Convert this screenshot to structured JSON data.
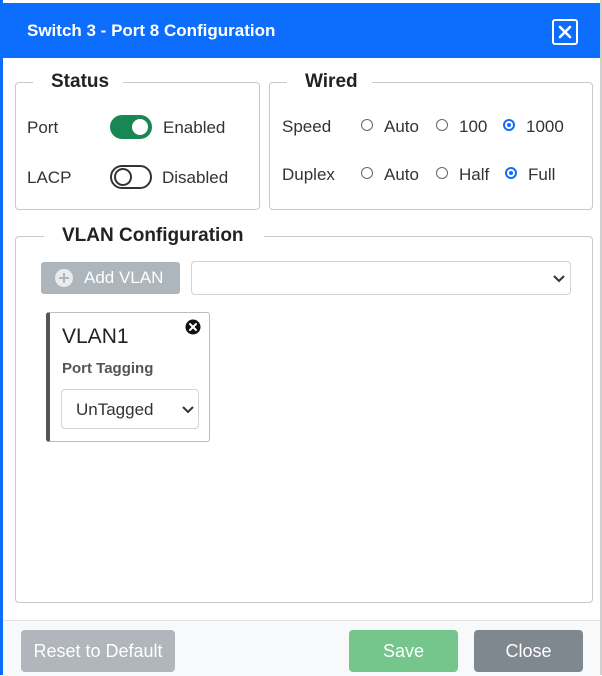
{
  "dialog": {
    "title": "Switch 3 - Port 8 Configuration"
  },
  "status": {
    "legend": "Status",
    "port_label": "Port",
    "port_state": "Enabled",
    "port_on": true,
    "lacp_label": "LACP",
    "lacp_state": "Disabled",
    "lacp_on": false
  },
  "wired": {
    "legend": "Wired",
    "speed_label": "Speed",
    "speed_options": [
      "Auto",
      "100",
      "1000"
    ],
    "speed_selected": "1000",
    "duplex_label": "Duplex",
    "duplex_options": [
      "Auto",
      "Half",
      "Full"
    ],
    "duplex_selected": "Full"
  },
  "vlan": {
    "legend": "VLAN Configuration",
    "add_label": "Add VLAN",
    "select_value": "",
    "cards": [
      {
        "name": "VLAN1",
        "tag_label": "Port Tagging",
        "tag_value": "UnTagged"
      }
    ]
  },
  "footer": {
    "reset_label": "Reset to Default",
    "save_label": "Save",
    "close_label": "Close"
  },
  "colors": {
    "primary": "#0d6efd",
    "toggle_on": "#198754",
    "save": "#74c68c",
    "close": "#7f878f",
    "reset": "#b0b6bb"
  },
  "icons": {
    "close": "close-icon",
    "add": "plus-circle-icon",
    "remove": "remove-circle-icon",
    "dropdown": "chevron-down-icon"
  }
}
